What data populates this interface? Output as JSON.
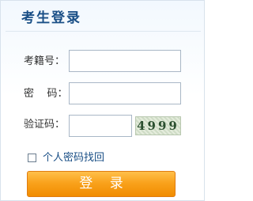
{
  "title": "考生登录",
  "form": {
    "exam_no_label": "考籍号：",
    "exam_no_value": "",
    "password_label": "密    码：",
    "password_value": "",
    "captcha_label": "验证码：",
    "captcha_value": "",
    "captcha_image_text": "4999"
  },
  "remember_label": "个人密码找回",
  "login_button_label": "登 录",
  "colors": {
    "title": "#1a4f86",
    "button": "#f9a21c",
    "link": "#1a4f86"
  }
}
